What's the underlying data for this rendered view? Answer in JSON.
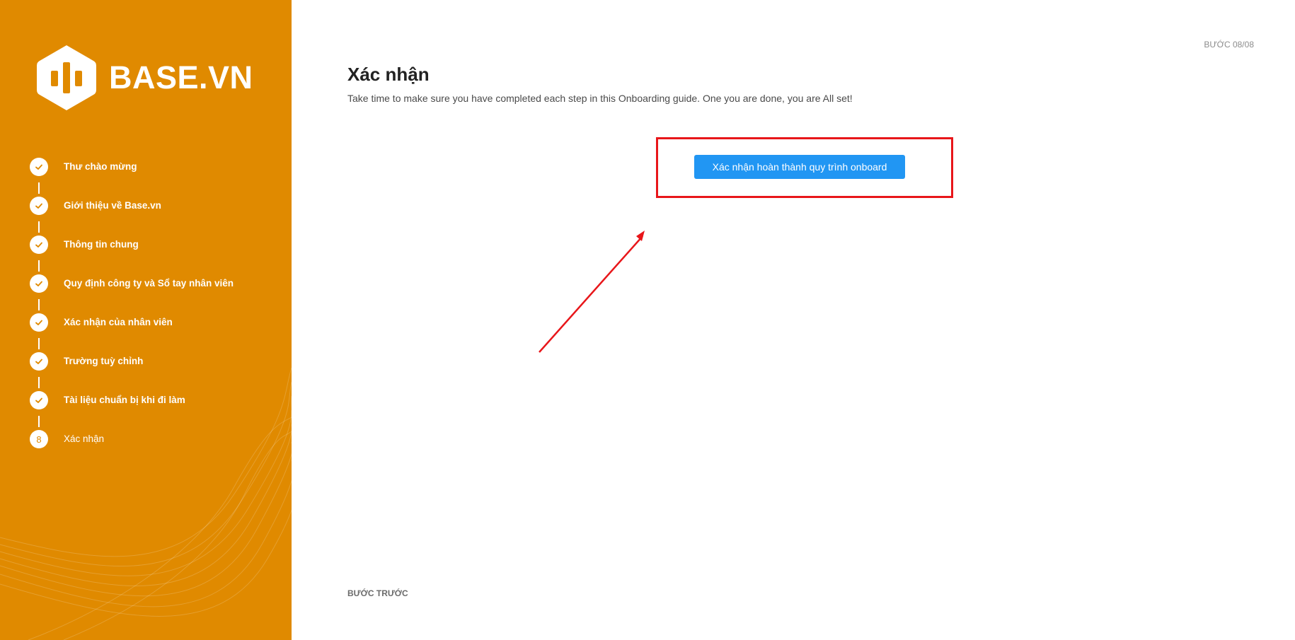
{
  "brand": {
    "name": "BASE.VN",
    "sidebar_color": "#e08a00",
    "logo_icon": "base-hexagon-logo-icon"
  },
  "steps": [
    {
      "label": "Thư chào mừng",
      "status": "done"
    },
    {
      "label": "Giới thiệu về Base.vn",
      "status": "done"
    },
    {
      "label": "Thông tin chung",
      "status": "done"
    },
    {
      "label": "Quy định công ty và Sổ tay nhân viên",
      "status": "done"
    },
    {
      "label": "Xác nhận của nhân viên",
      "status": "done"
    },
    {
      "label": "Trường tuỳ chỉnh",
      "status": "done"
    },
    {
      "label": "Tài liệu chuẩn bị khi đi làm",
      "status": "done"
    },
    {
      "label": "Xác nhận",
      "status": "current",
      "number": "8"
    }
  ],
  "header": {
    "step_counter": "BƯỚC 08/08"
  },
  "main": {
    "title": "Xác nhận",
    "subtitle": "Take time to make sure you have completed each step in this Onboarding guide. One you are done, you are All set!",
    "confirm_button_label": "Xác nhận hoàn thành quy trình onboard",
    "button_color": "#2196f3",
    "annotation_color": "#e8161a"
  },
  "footer": {
    "prev_label": "BƯỚC TRƯỚC"
  }
}
